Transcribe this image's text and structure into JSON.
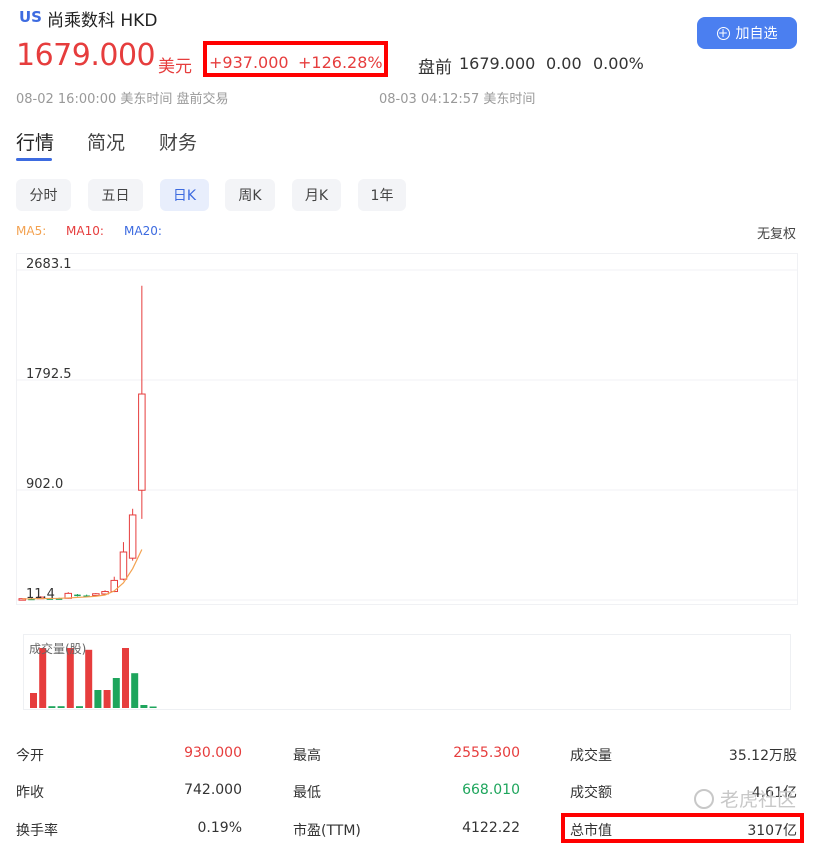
{
  "header": {
    "market_badge": "US",
    "name": "尚乘数科 HKD",
    "price": "1679.000",
    "currency": "美元",
    "change_abs": "+937.000",
    "change_pct": "+126.28%",
    "premarket_label": "盘前",
    "premarket_price": "1679.000",
    "premarket_change": "0.00",
    "premarket_pct": "0.00%",
    "watchlist_button": "加自选",
    "time_left": "08-02 16:00:00 美东时间 盘前交易",
    "time_right": "08-03 04:12:57 美东时间"
  },
  "tabs": [
    "行情",
    "简况",
    "财务"
  ],
  "periods": [
    "分时",
    "五日",
    "日K",
    "周K",
    "月K",
    "1年"
  ],
  "active_period": "日K",
  "ma_labels": {
    "ma5": "MA5:",
    "ma10": "MA10:",
    "ma20": "MA20:"
  },
  "adjust_label": "无复权",
  "colors": {
    "up": "#e63d3d",
    "down": "#1ea55c",
    "ma5": "#f3a251",
    "ma20": "#3d6be0",
    "accent": "#4b7ff0"
  },
  "chart_data": {
    "type": "candlestick",
    "y_ticks": [
      "2683.1",
      "1792.5",
      "902.0",
      "11.4"
    ],
    "ylim": [
      11.4,
      2683.1
    ],
    "candles": [
      {
        "open": 20,
        "close": 22,
        "high": 25,
        "low": 15,
        "dir": "up"
      },
      {
        "open": 22,
        "close": 20,
        "high": 28,
        "low": 18,
        "dir": "down"
      },
      {
        "open": 22,
        "close": 35,
        "high": 42,
        "low": 20,
        "dir": "up"
      },
      {
        "open": 25,
        "close": 22,
        "high": 28,
        "low": 20,
        "dir": "down"
      },
      {
        "open": 25,
        "close": 22,
        "high": 30,
        "low": 20,
        "dir": "down"
      },
      {
        "open": 25,
        "close": 65,
        "high": 75,
        "low": 22,
        "dir": "up"
      },
      {
        "open": 55,
        "close": 45,
        "high": 60,
        "low": 40,
        "dir": "down"
      },
      {
        "open": 48,
        "close": 42,
        "high": 55,
        "low": 38,
        "dir": "down"
      },
      {
        "open": 48,
        "close": 62,
        "high": 68,
        "low": 45,
        "dir": "up"
      },
      {
        "open": 60,
        "close": 80,
        "high": 90,
        "low": 58,
        "dir": "up"
      },
      {
        "open": 80,
        "close": 170,
        "high": 200,
        "low": 75,
        "dir": "up"
      },
      {
        "open": 180,
        "close": 400,
        "high": 480,
        "low": 170,
        "dir": "up"
      },
      {
        "open": 350,
        "close": 700,
        "high": 750,
        "low": 330,
        "dir": "up"
      },
      {
        "open": 900,
        "close": 1679,
        "high": 2555.3,
        "low": 668.01,
        "dir": "up"
      }
    ],
    "ma5": [
      20,
      21,
      23,
      24,
      25,
      28,
      32,
      36,
      42,
      52,
      85,
      150,
      265,
      420
    ],
    "volume_title": "成交量(股)",
    "volumes": [
      {
        "v": 0.25,
        "dir": "up"
      },
      {
        "v": 1.0,
        "dir": "up"
      },
      {
        "v": 0.03,
        "dir": "down"
      },
      {
        "v": 0.03,
        "dir": "down"
      },
      {
        "v": 1.0,
        "dir": "up"
      },
      {
        "v": 0.03,
        "dir": "down"
      },
      {
        "v": 0.97,
        "dir": "up"
      },
      {
        "v": 0.3,
        "dir": "down"
      },
      {
        "v": 0.3,
        "dir": "up"
      },
      {
        "v": 0.5,
        "dir": "down"
      },
      {
        "v": 1.0,
        "dir": "up"
      },
      {
        "v": 0.58,
        "dir": "down"
      },
      {
        "v": 0.05,
        "dir": "down"
      },
      {
        "v": 0.02,
        "dir": "down"
      }
    ]
  },
  "stats": [
    {
      "label": "今开",
      "value": "930.000",
      "tone": "red"
    },
    {
      "label": "最高",
      "value": "2555.300",
      "tone": "red"
    },
    {
      "label": "成交量",
      "value": "35.12万股",
      "tone": ""
    },
    {
      "label": "昨收",
      "value": "742.000",
      "tone": ""
    },
    {
      "label": "最低",
      "value": "668.010",
      "tone": "green"
    },
    {
      "label": "成交额",
      "value": "4.61亿",
      "tone": ""
    },
    {
      "label": "换手率",
      "value": "0.19%",
      "tone": ""
    },
    {
      "label": "市盈(TTM)",
      "value": "4122.22",
      "tone": ""
    },
    {
      "label": "总市值",
      "value": "3107亿",
      "tone": ""
    }
  ],
  "watermark": "老虎社区"
}
